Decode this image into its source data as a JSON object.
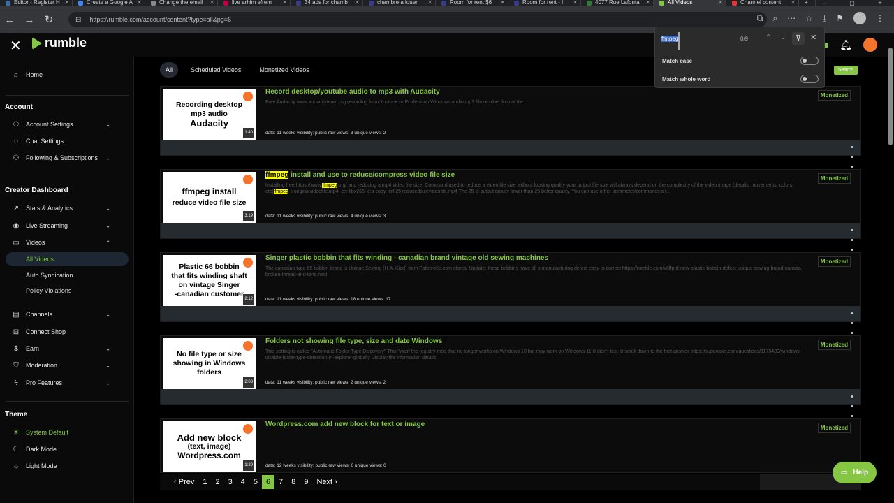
{
  "browser": {
    "tabs": [
      {
        "label": "Editor ‹ Register H",
        "color": "#3b6ea5"
      },
      {
        "label": "Create a Google A",
        "color": "#4285f4"
      },
      {
        "label": "Change the email",
        "color": "#888888"
      },
      {
        "label": "live arhim efrem",
        "color": "#c00046"
      },
      {
        "label": "34 ads for chamb",
        "color": "#373c8f"
      },
      {
        "label": "chambre a louer",
        "color": "#373c8f"
      },
      {
        "label": "Room for rent $6",
        "color": "#373c8f"
      },
      {
        "label": "Room for rent - I",
        "color": "#373c8f"
      },
      {
        "label": "4077 Rue Lafonta",
        "color": "#2e7d32"
      },
      {
        "label": "All Videos",
        "color": "#85c742",
        "active": true
      },
      {
        "label": "Channel content",
        "color": "#e53935"
      }
    ],
    "url": "https://rumble.com/account/content?type=all&pg=6"
  },
  "header": {
    "logo": "rumble"
  },
  "find": {
    "query": "ffmpeg",
    "count": "0/9",
    "match_case_label": "Match case",
    "whole_word_label": "Match whole word"
  },
  "sidebar": {
    "home": "Home",
    "account_heading": "Account",
    "account_settings": "Account Settings",
    "chat_settings": "Chat Settings",
    "following": "Following & Subscriptions",
    "creator_heading": "Creator Dashboard",
    "stats": "Stats & Analytics",
    "live": "Live Streaming",
    "videos": "Videos",
    "all_videos": "All Videos",
    "auto_syndication": "Auto Syndication",
    "policy": "Policy Violations",
    "channels": "Channels",
    "connect_shop": "Connect Shop",
    "earn": "Earn",
    "moderation": "Moderation",
    "pro": "Pro Features",
    "theme_heading": "Theme",
    "system_default": "System Default",
    "dark_mode": "Dark Mode",
    "light_mode": "Light Mode"
  },
  "filters": {
    "all": "All",
    "scheduled": "Scheduled Videos",
    "monetized": "Monetized Videos",
    "search": "Search"
  },
  "videos": [
    {
      "thumb_lines": [
        "Recording desktop",
        "mp3 audio",
        "Audacity"
      ],
      "duration": "1:40",
      "title": "Record desktop/youtube audio to mp3 with Audacity",
      "desc": "Free Audacity www.audacityteam.org recording from Youtube or Pc desktop Windows audio mp3 file or other format file",
      "meta": "date: 11 weeks  visibility: public  raw views: 3  unique views: 2",
      "badge": "Monetized"
    },
    {
      "thumb_lines": [
        "ffmpeg install",
        "reduce video file size"
      ],
      "duration": "3:19",
      "title_hl": "ffmpeg",
      "title": " install and use to reduce/compress video file size",
      "desc_a": "Installing free https://www.",
      "desc_hl1": "ffmpeg",
      "desc_b": ".org/ and reducing a mp4 video file size. Command used to reduce a video file size without loosing quality your output file size will always depend on the complexity of the video image (details, movements, colors, etc)",
      "desc_hl2": "ffmpeg",
      "desc_c": " -i originalvideofile.mp4 -c:v libx265 -c:a copy -crf 25 reducedsizevideofile.mp4 The 25 is output quality lower than 25 better quality. You can use other parameter/commands s t...",
      "meta": "date: 11 weeks  visibility: public  raw views: 4  unique views: 3",
      "badge": "Monetized"
    },
    {
      "thumb_lines": [
        "Plastic 66 bobbin",
        "that fits winding shaft",
        "on vintage Singer",
        "-canadian customer"
      ],
      "duration": "2:12",
      "title": "Singer plastic bobbin that fits winding - canadian brand vintage old sewing machines",
      "desc": "The canadian type 66 bobbin brand is Unique Sewing (H.A. Kidd) from Fabricville.com stores. Update: these bobbins have all a manufacturing defect easy to correct https://rumble.com/v6ffprd-new-plastic-bobbin-defect-unique-sewing-brand-canada-broken-thread-and-tens.html",
      "meta": "date: 11 weeks  visibility: public  raw views: 18  unique views: 17",
      "badge": "Monetized"
    },
    {
      "thumb_lines": [
        "No file type or size",
        "showing in Windows",
        "folders"
      ],
      "duration": "2:03",
      "title": "Folders not showing file type, size and date Windows",
      "desc": "This setting is called \"Automatic Folder Type Discovery\" This \"was\" the registry mod that no longer works on Windows 10 but may work on Windows 11 (I didn't test it) scroll down to the first answer https://superuser.com/questions/1175439/windows-disable-folder-type-detection-in-explorer-globally Display file information details",
      "meta": "date: 11 weeks  visibility: public  raw views: 2  unique views: 2",
      "badge": "Monetized"
    },
    {
      "thumb_lines": [
        "Add new block",
        "(text, image)",
        "Wordpress.com"
      ],
      "duration": "1:29",
      "title": "Wordpress.com add new block for text or image",
      "desc": "",
      "meta": "date: 12 weeks  visibility: public  raw views: 0  unique views: 0",
      "badge": "Monetized"
    }
  ],
  "pager": {
    "prev": "Prev",
    "next": "Next",
    "pages": [
      "1",
      "2",
      "3",
      "4",
      "5",
      "6",
      "7",
      "8",
      "9"
    ],
    "current": "6"
  },
  "help": "Help"
}
